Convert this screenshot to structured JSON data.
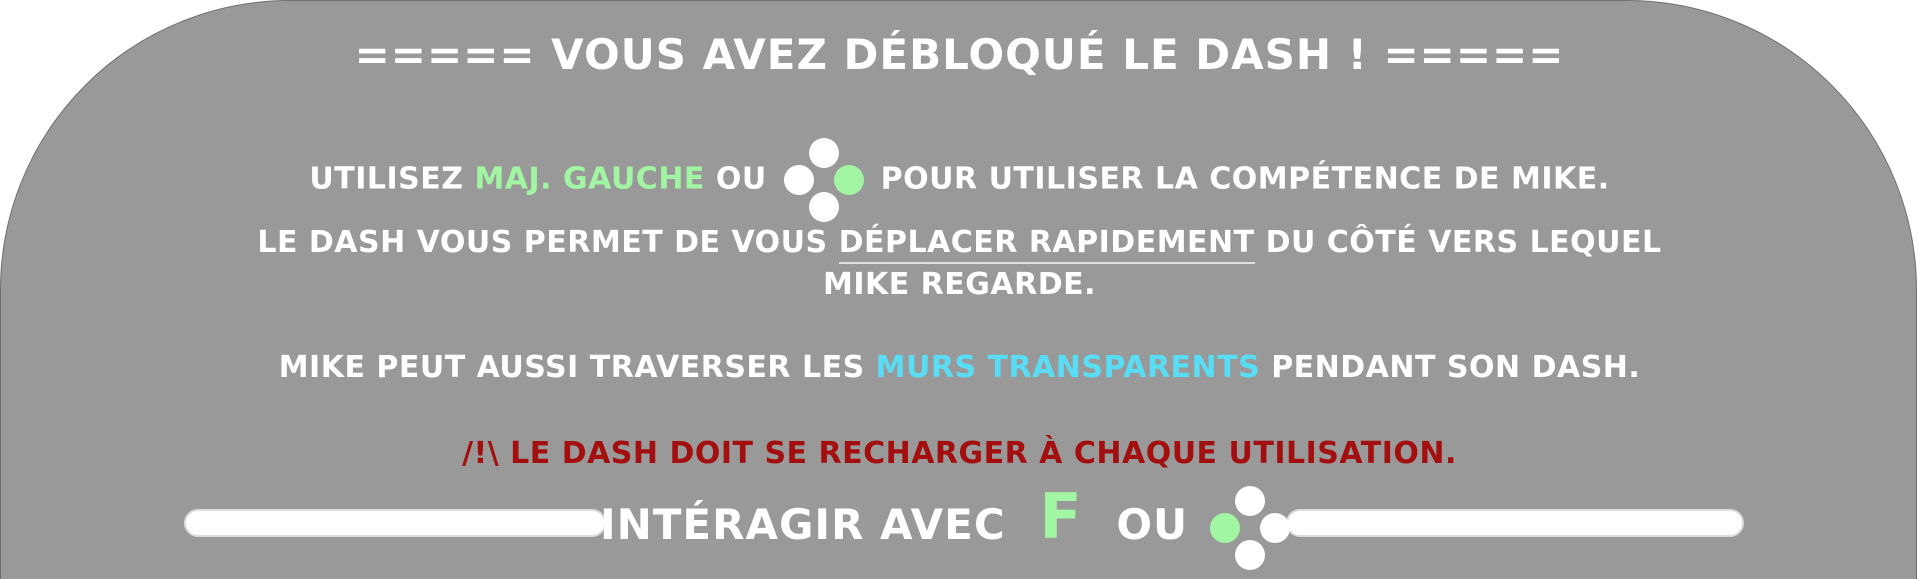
{
  "dialog": {
    "title": "===== VOUS AVEZ DÉBLOQUÉ LE DASH ! =====",
    "line1": {
      "before": "UTILISEZ",
      "key": "MAJ. GAUCHE",
      "mid": "OU",
      "after": "POUR UTILISER LA COMPÉTENCE DE MIKE.",
      "gamepad_highlight": "right"
    },
    "line2": {
      "before": "LE DASH VOUS PERMET DE VOUS",
      "emphasis": "DÉPLACER RAPIDEMENT",
      "after": "DU CÔTÉ VERS LEQUEL MIKE REGARDE."
    },
    "line3": {
      "before": "MIKE PEUT AUSSI TRAVERSER LES",
      "highlight": "MURS TRANSPARENTS",
      "after": "PENDANT SON DASH."
    },
    "warning": "/!\\ LE DASH DOIT SE RECHARGER À CHAQUE UTILISATION.",
    "interact": {
      "label": "INTÉRAGIR AVEC",
      "key": "F",
      "or": "OU",
      "gamepad_highlight": "left"
    }
  },
  "colors": {
    "panel": "#999999",
    "text": "#ffffff",
    "key_green": "#a2f5a2",
    "highlight_cyan": "#59ddf5",
    "warning_red": "#a30f0f"
  },
  "icons": [
    "gamepad-face-buttons-icon"
  ]
}
